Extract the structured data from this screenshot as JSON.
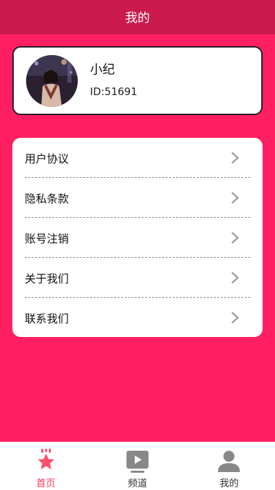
{
  "header": {
    "title": "我的"
  },
  "profile": {
    "name": "小纪",
    "id_text": "ID:51691"
  },
  "menu": {
    "items": [
      {
        "label": "用户协议"
      },
      {
        "label": "隐私条款"
      },
      {
        "label": "账号注销"
      },
      {
        "label": "关于我们"
      },
      {
        "label": "联系我们"
      }
    ]
  },
  "tabbar": {
    "tabs": [
      {
        "label": "首页",
        "icon": "star-icon",
        "active": true
      },
      {
        "label": "频道",
        "icon": "play-video-icon",
        "active": false
      },
      {
        "label": "我的",
        "icon": "user-icon",
        "active": false
      }
    ]
  },
  "colors": {
    "background": "#ff1f62",
    "header": "#cc1a4e",
    "active_tab": "#ff3a63"
  }
}
